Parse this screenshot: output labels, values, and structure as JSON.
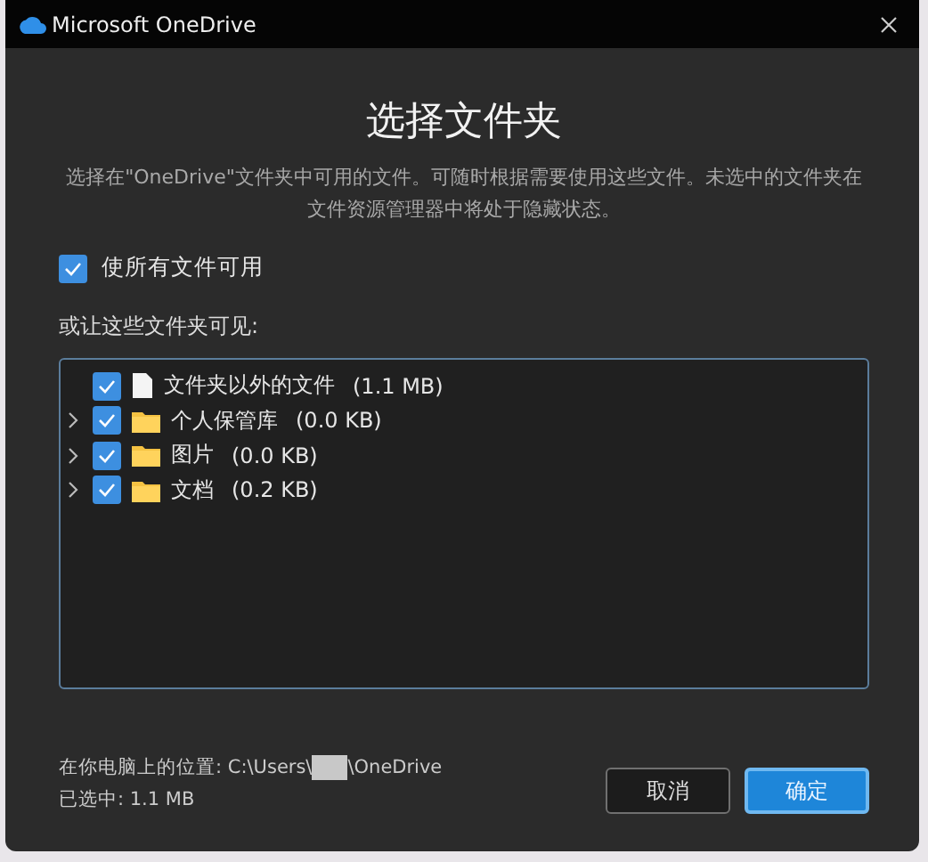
{
  "window": {
    "title": "Microsoft OneDrive"
  },
  "heading": "选择文件夹",
  "description": "选择在\"OneDrive\"文件夹中可用的文件。可随时根据需要使用这些文件。未选中的文件夹在文件资源管理器中将处于隐藏状态。",
  "all_files": {
    "label": "使所有文件可用",
    "checked": true
  },
  "tree_label": "或让这些文件夹可见:",
  "tree": [
    {
      "kind": "file",
      "name": "文件夹以外的文件",
      "size": "(1.1 MB)",
      "checked": true
    },
    {
      "kind": "folder",
      "name": "个人保管库",
      "size": "(0.0 KB)",
      "checked": true
    },
    {
      "kind": "folder",
      "name": "图片",
      "size": "(0.0 KB)",
      "checked": true
    },
    {
      "kind": "folder",
      "name": "文档",
      "size": "(0.2 KB)",
      "checked": true
    }
  ],
  "location": {
    "prefix": "在你电脑上的位置: C:\\Users\\",
    "suffix": "\\OneDrive"
  },
  "selected_size": "已选中: 1.1 MB",
  "buttons": [
    {
      "label": "取消",
      "kind": "secondary"
    },
    {
      "label": "确定",
      "kind": "primary"
    }
  ]
}
